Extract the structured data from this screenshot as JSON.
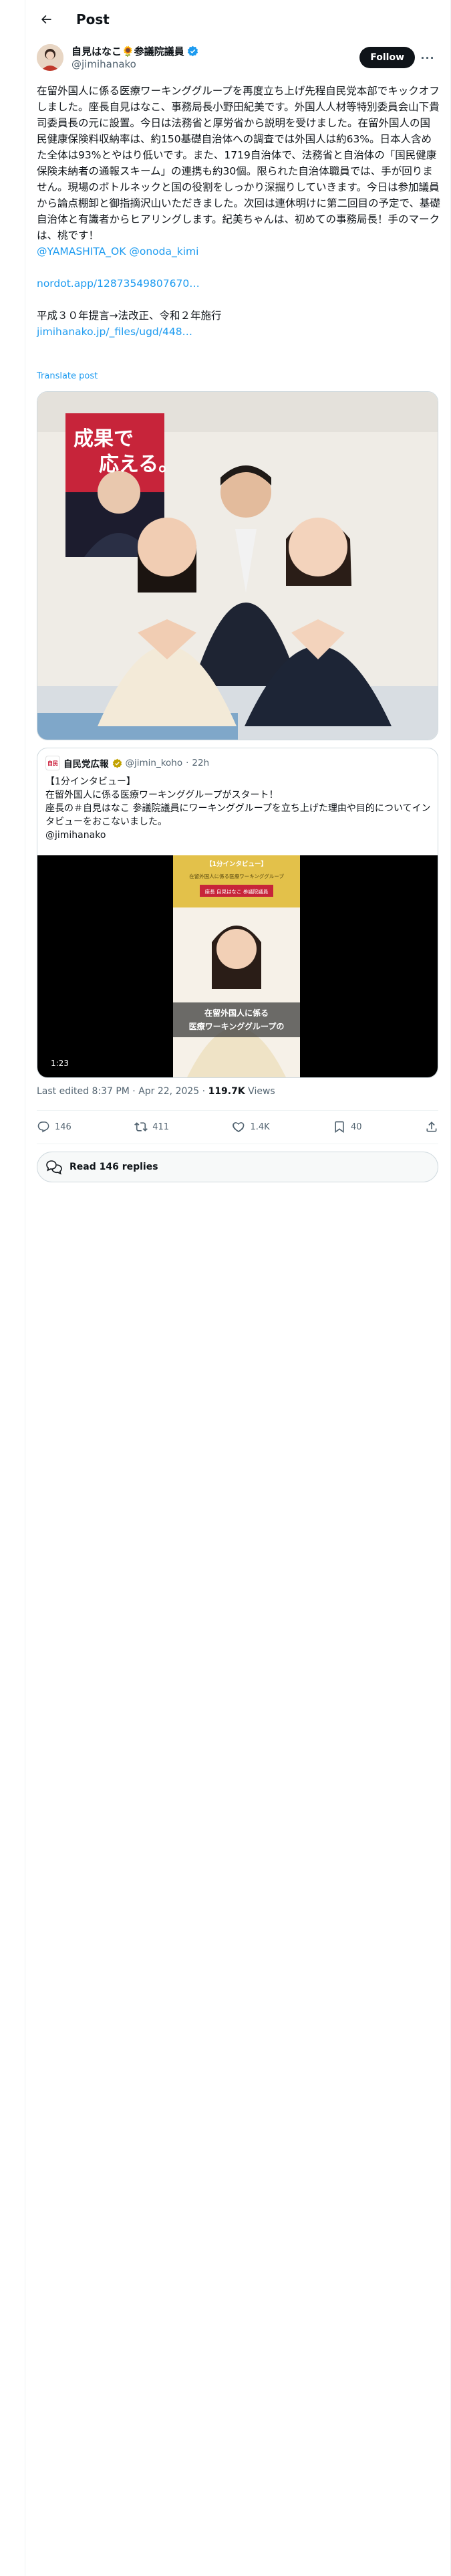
{
  "header": {
    "title": "Post"
  },
  "author": {
    "name": "自見はなこ🌻参議院議員",
    "handle": "@jimihanako",
    "follow_label": "Follow",
    "verified_color": "#1d9bf0"
  },
  "post": {
    "paragraph1": "在留外国人に係る医療ワーキンググループを再度立ち上げ先程自民党本部でキックオフしました。座長自見はなこ、事務局長小野田紀美です。外国人人材等特別委員会山下貴司委員長の元に設置。今日は法務省と厚労省から説明を受けました。在留外国人の国民健康保険料収納率は、約150基礎自治体への調査では外国人は約63%。日本人含めた全体は93%とやはり低いです。また、1719自治体で、法務省と自治体の「国民健康保険未納者の通報スキーム」の連携も約30個。限られた自治体職員では、手が回りません。現場のボトルネックと国の役割をしっかり深掘りしていきます。今日は参加議員から論点棚卸と御指摘沢山いただきました。次回は連休明けに第二回目の予定で、基礎自治体と有識者からヒアリングします。紀美ちゃんは、初めての事務局長！手のマークは、桃です！",
    "mention1": "@YAMASHITA_OK",
    "mention2": "@onoda_kimi",
    "link1": "nordot.app/12873549807670…",
    "line2": "平成３０年提言→法改正、令和２年施行",
    "link2": "jimihanako.jp/_files/ugd/448…",
    "translate": "Translate post"
  },
  "photo": {
    "poster_text_1": "成果で",
    "poster_text_2": "応える。"
  },
  "quote": {
    "logo_text": "自民",
    "name": "自民党広報",
    "handle": "@jimin_koho",
    "time": "22h",
    "line1": "【1分インタビュー】",
    "line2": "在留外国人に係る医療ワーキンググループがスタート！",
    "line3": "座長の＃自見はなこ 参議院議員にワーキンググループを立ち上げた理由や目的についてインタビューをおこないました。",
    "line4": "@jimihanako",
    "video_top_label": "【1分インタビュー】",
    "video_sub_label": "在留外国人に係る医療ワーキンググループ",
    "video_name_label": "座長 自見はなこ 参議院議員",
    "video_caption1": "在留外国人に係る",
    "video_caption2": "医療ワーキンググループの",
    "duration": "1:23"
  },
  "meta": {
    "edited": "Last edited 8:37 PM · Apr 22, 2025 · ",
    "views_count": "119.7K",
    "views_label": " Views"
  },
  "actions": {
    "replies": "146",
    "reposts": "411",
    "likes": "1.4K",
    "bookmarks": "40"
  },
  "read_replies": "Read 146 replies"
}
